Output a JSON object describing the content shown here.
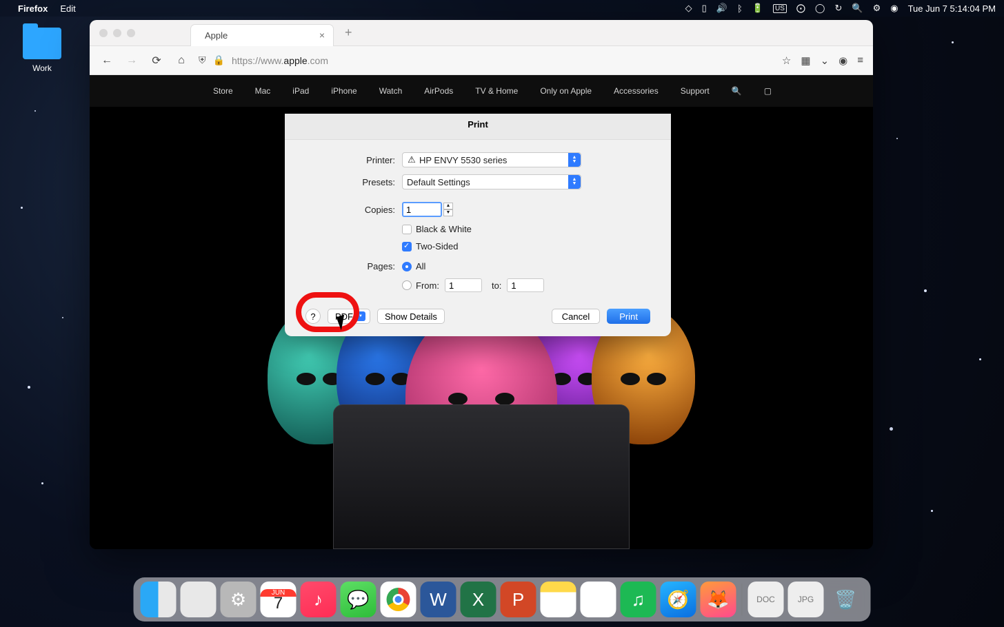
{
  "menubar": {
    "app_name": "Firefox",
    "menus": [
      "Edit"
    ],
    "datetime": "Tue Jun 7  5:14:04 PM",
    "input_indicator": "US"
  },
  "desktop": {
    "work_folder_label": "Work"
  },
  "browser": {
    "tab_title": "Apple",
    "url_display_prefix": "https://www.",
    "url_display_domain": "apple",
    "url_display_suffix": ".com"
  },
  "apple_nav": {
    "items": [
      "Store",
      "Mac",
      "iPad",
      "iPhone",
      "Watch",
      "AirPods",
      "TV & Home",
      "Only on Apple",
      "Accessories",
      "Support"
    ]
  },
  "print_dialog": {
    "title": "Print",
    "printer_label": "Printer:",
    "printer_value": "HP ENVY 5530 series",
    "presets_label": "Presets:",
    "presets_value": "Default Settings",
    "copies_label": "Copies:",
    "copies_value": "1",
    "bw_label": "Black & White",
    "bw_checked": false,
    "twosided_label": "Two-Sided",
    "twosided_checked": true,
    "pages_label": "Pages:",
    "pages_all_label": "All",
    "pages_from_label": "From:",
    "pages_from_value": "1",
    "pages_to_label": "to:",
    "pages_to_value": "1",
    "pdf_button": "PDF",
    "show_details_button": "Show Details",
    "cancel_button": "Cancel",
    "print_button": "Print",
    "help_button": "?"
  },
  "dock": {
    "calendar_month": "JUN",
    "calendar_day": "7"
  }
}
